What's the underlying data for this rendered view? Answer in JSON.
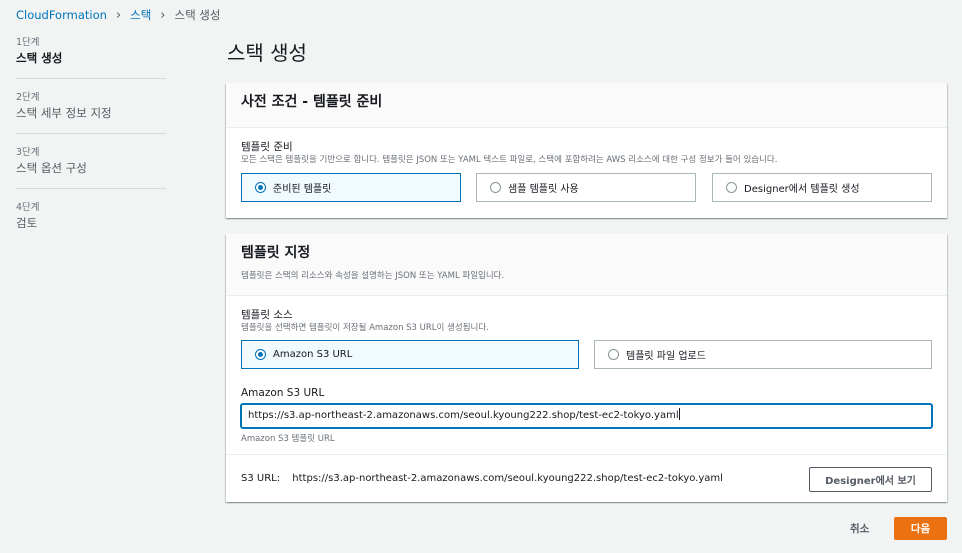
{
  "breadcrumb": {
    "items": [
      "CloudFormation",
      "스택"
    ],
    "current": "스택 생성"
  },
  "steps": [
    {
      "num": "1단계",
      "label": "스택 생성",
      "active": true
    },
    {
      "num": "2단계",
      "label": "스택 세부 정보 지정",
      "active": false
    },
    {
      "num": "3단계",
      "label": "스택 옵션 구성",
      "active": false
    },
    {
      "num": "4단계",
      "label": "검토",
      "active": false
    }
  ],
  "page": {
    "title": "스택 생성"
  },
  "prereq": {
    "title": "사전 조건 - 템플릿 준비",
    "field_label": "템플릿 준비",
    "field_desc": "모든 스택은 템플릿을 기반으로 합니다. 템플릿은 JSON 또는 YAML 텍스트 파일로, 스택에 포함하려는 AWS 리소스에 대한 구성 정보가 들어 있습니다.",
    "options": [
      "준비된 템플릿",
      "샘플 템플릿 사용",
      "Designer에서 템플릿 생성"
    ],
    "selected": "준비된 템플릿"
  },
  "template": {
    "title": "템플릿 지정",
    "desc": "템플릿은 스택의 리소스와 속성을 설명하는 JSON 또는 YAML 파일입니다.",
    "source_label": "템플릿 소스",
    "source_desc": "템플릿을 선택하면 템플릿이 저장될 Amazon S3 URL이 생성됩니다.",
    "sources": [
      "Amazon S3 URL",
      "템플릿 파일 업로드"
    ],
    "selected_source": "Amazon S3 URL",
    "url_label": "Amazon S3 URL",
    "url_value": "https://s3.ap-northeast-2.amazonaws.com/seoul.kyoung222.shop/test-ec2-tokyo.yaml",
    "url_hint": "Amazon S3 템플릿 URL",
    "s3_label": "S3 URL:",
    "s3_value": "https://s3.ap-northeast-2.amazonaws.com/seoul.kyoung222.shop/test-ec2-tokyo.yaml",
    "designer_button": "Designer에서 보기"
  },
  "footer": {
    "cancel": "취소",
    "next": "다음"
  },
  "colors": {
    "accent": "#0073bb",
    "primary_button": "#ec7211",
    "background": "#f2f3f3"
  }
}
